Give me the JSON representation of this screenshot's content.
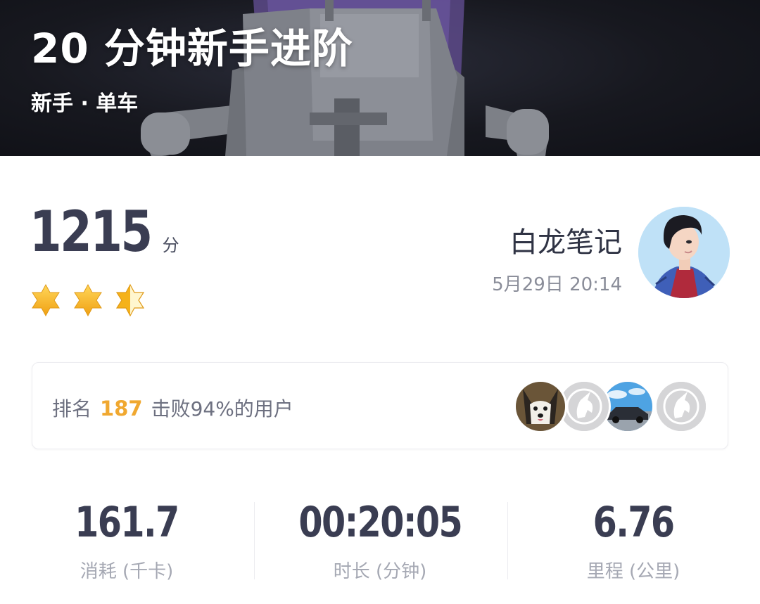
{
  "header": {
    "title": "20 分钟新手进阶",
    "subtitle": "新手 · 单车"
  },
  "result": {
    "score": "1215",
    "score_unit": "分",
    "stars": {
      "rating": 2.5,
      "max": 3
    },
    "user_name": "白龙笔记",
    "datetime": "5月29日 20:14"
  },
  "ranking": {
    "prefix": "排名",
    "rank": "187",
    "suffix": "击败94%的用户",
    "avatars": [
      "husky-dog-avatar",
      "unicorn-logo-avatar",
      "sports-car-avatar",
      "unicorn-logo-avatar"
    ]
  },
  "stats": [
    {
      "value": "161.7",
      "label": "消耗 (千卡)"
    },
    {
      "value": "00:20:05",
      "label": "时长 (分钟)"
    },
    {
      "value": "6.76",
      "label": "里程 (公里)"
    }
  ],
  "colors": {
    "accent_rank": "#f0a830",
    "text_primary": "#3a3d52",
    "text_secondary": "#8a8d99",
    "star_gold": "#f5b21a"
  }
}
